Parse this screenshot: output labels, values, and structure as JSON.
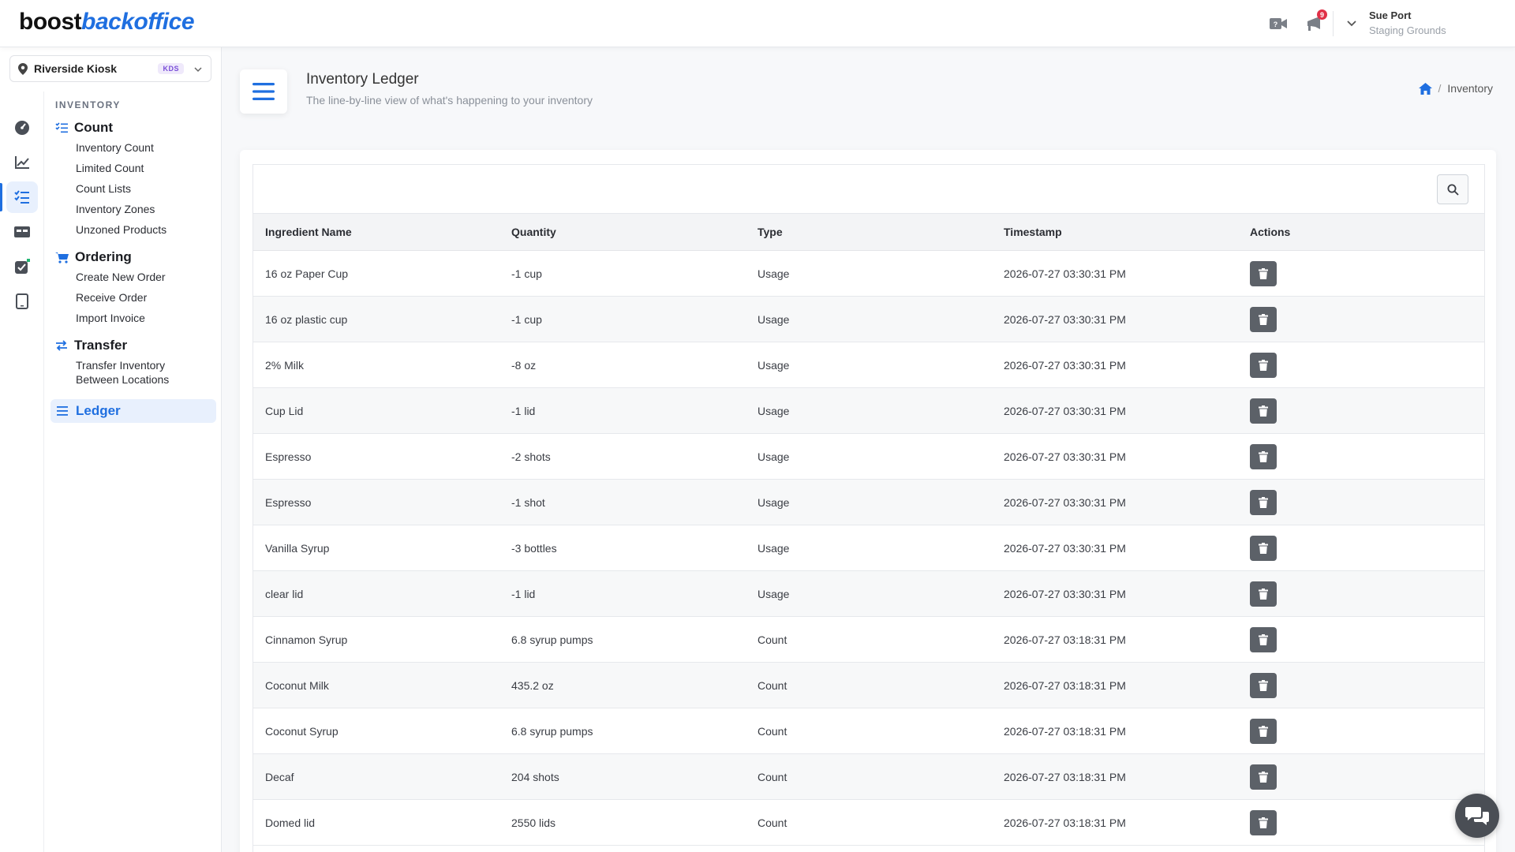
{
  "app": {
    "logo_part1": "boost",
    "logo_part2": "backoffice"
  },
  "topbar": {
    "notifications_count": "9",
    "user_name": "Sue Port",
    "user_org": "Staging Grounds"
  },
  "location": {
    "name": "Riverside Kiosk",
    "badge": "KDS"
  },
  "nav": {
    "section_label": "INVENTORY",
    "count_title": "Count",
    "count_items": [
      "Inventory Count",
      "Limited Count",
      "Count Lists",
      "Inventory Zones",
      "Unzoned Products"
    ],
    "ordering_title": "Ordering",
    "ordering_items": [
      "Create New Order",
      "Receive Order",
      "Import Invoice"
    ],
    "transfer_title": "Transfer",
    "transfer_item_line1": "Transfer Inventory",
    "transfer_item_line2": "Between Locations",
    "ledger_title": "Ledger"
  },
  "header": {
    "title": "Inventory Ledger",
    "subtitle": "The line-by-line view of what's happening to your inventory",
    "breadcrumb": "Inventory"
  },
  "table": {
    "columns": [
      "Ingredient Name",
      "Quantity",
      "Type",
      "Timestamp",
      "Actions"
    ],
    "rows": [
      {
        "name": "16 oz Paper Cup",
        "qty": "-1 cup",
        "type": "Usage",
        "ts": "2026-07-27 03:30:31 PM"
      },
      {
        "name": "16 oz plastic cup",
        "qty": "-1 cup",
        "type": "Usage",
        "ts": "2026-07-27 03:30:31 PM"
      },
      {
        "name": "2% Milk",
        "qty": "-8 oz",
        "type": "Usage",
        "ts": "2026-07-27 03:30:31 PM"
      },
      {
        "name": "Cup Lid",
        "qty": "-1 lid",
        "type": "Usage",
        "ts": "2026-07-27 03:30:31 PM"
      },
      {
        "name": "Espresso",
        "qty": "-2 shots",
        "type": "Usage",
        "ts": "2026-07-27 03:30:31 PM"
      },
      {
        "name": "Espresso",
        "qty": "-1 shot",
        "type": "Usage",
        "ts": "2026-07-27 03:30:31 PM"
      },
      {
        "name": "Vanilla Syrup",
        "qty": "-3 bottles",
        "type": "Usage",
        "ts": "2026-07-27 03:30:31 PM"
      },
      {
        "name": "clear lid",
        "qty": "-1 lid",
        "type": "Usage",
        "ts": "2026-07-27 03:30:31 PM"
      },
      {
        "name": "Cinnamon Syrup",
        "qty": "6.8 syrup pumps",
        "type": "Count",
        "ts": "2026-07-27 03:18:31 PM"
      },
      {
        "name": "Coconut Milk",
        "qty": "435.2 oz",
        "type": "Count",
        "ts": "2026-07-27 03:18:31 PM"
      },
      {
        "name": "Coconut Syrup",
        "qty": "6.8 syrup pumps",
        "type": "Count",
        "ts": "2026-07-27 03:18:31 PM"
      },
      {
        "name": "Decaf",
        "qty": "204 shots",
        "type": "Count",
        "ts": "2026-07-27 03:18:31 PM"
      },
      {
        "name": "Domed lid",
        "qty": "2550 lids",
        "type": "Count",
        "ts": "2026-07-27 03:18:31 PM"
      }
    ]
  },
  "icons": {
    "location": "map-pin-icon",
    "video": "video-help-icon",
    "announce": "megaphone-icon",
    "search": "search-icon",
    "delete": "trash-icon",
    "chat": "chat-icon",
    "home": "home-icon"
  },
  "colors": {
    "accent": "#1f6fe0",
    "badge": "#e03047",
    "delete_button": "#5c6168"
  }
}
